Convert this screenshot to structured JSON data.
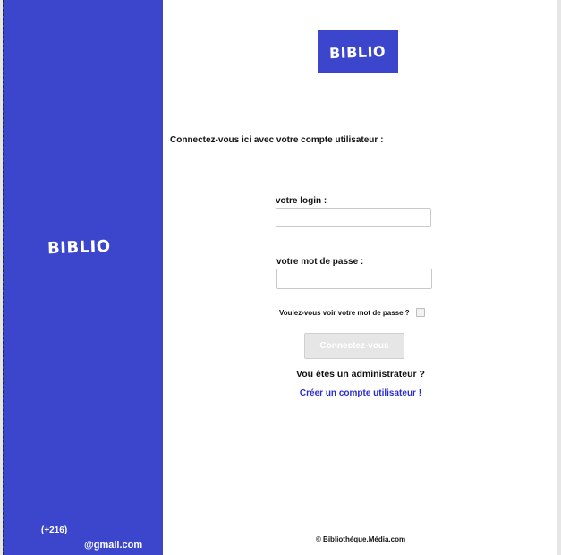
{
  "brand": {
    "sidebar_logo": "BIBLIO",
    "top_logo": "BIBLIO",
    "color": "#3c46cd"
  },
  "sidebar": {
    "phone": "(+216)",
    "email": "@gmail.com"
  },
  "login": {
    "intro": "Connectez-vous ici avec votre compte utilisateur :",
    "login_label": "votre login :",
    "login_value": "",
    "password_label": "votre mot de passe :",
    "password_value": "",
    "show_password_label": "Voulez-vous voir votre mot de passe ?",
    "show_password_checked": false,
    "submit_label": "Connectez-vous",
    "admin_text": "Vou êtes un administrateur ?",
    "create_account_link": "Créer un compte utilisateur !"
  },
  "footer": {
    "copyright": "© Bibliothéque.Média.com"
  }
}
